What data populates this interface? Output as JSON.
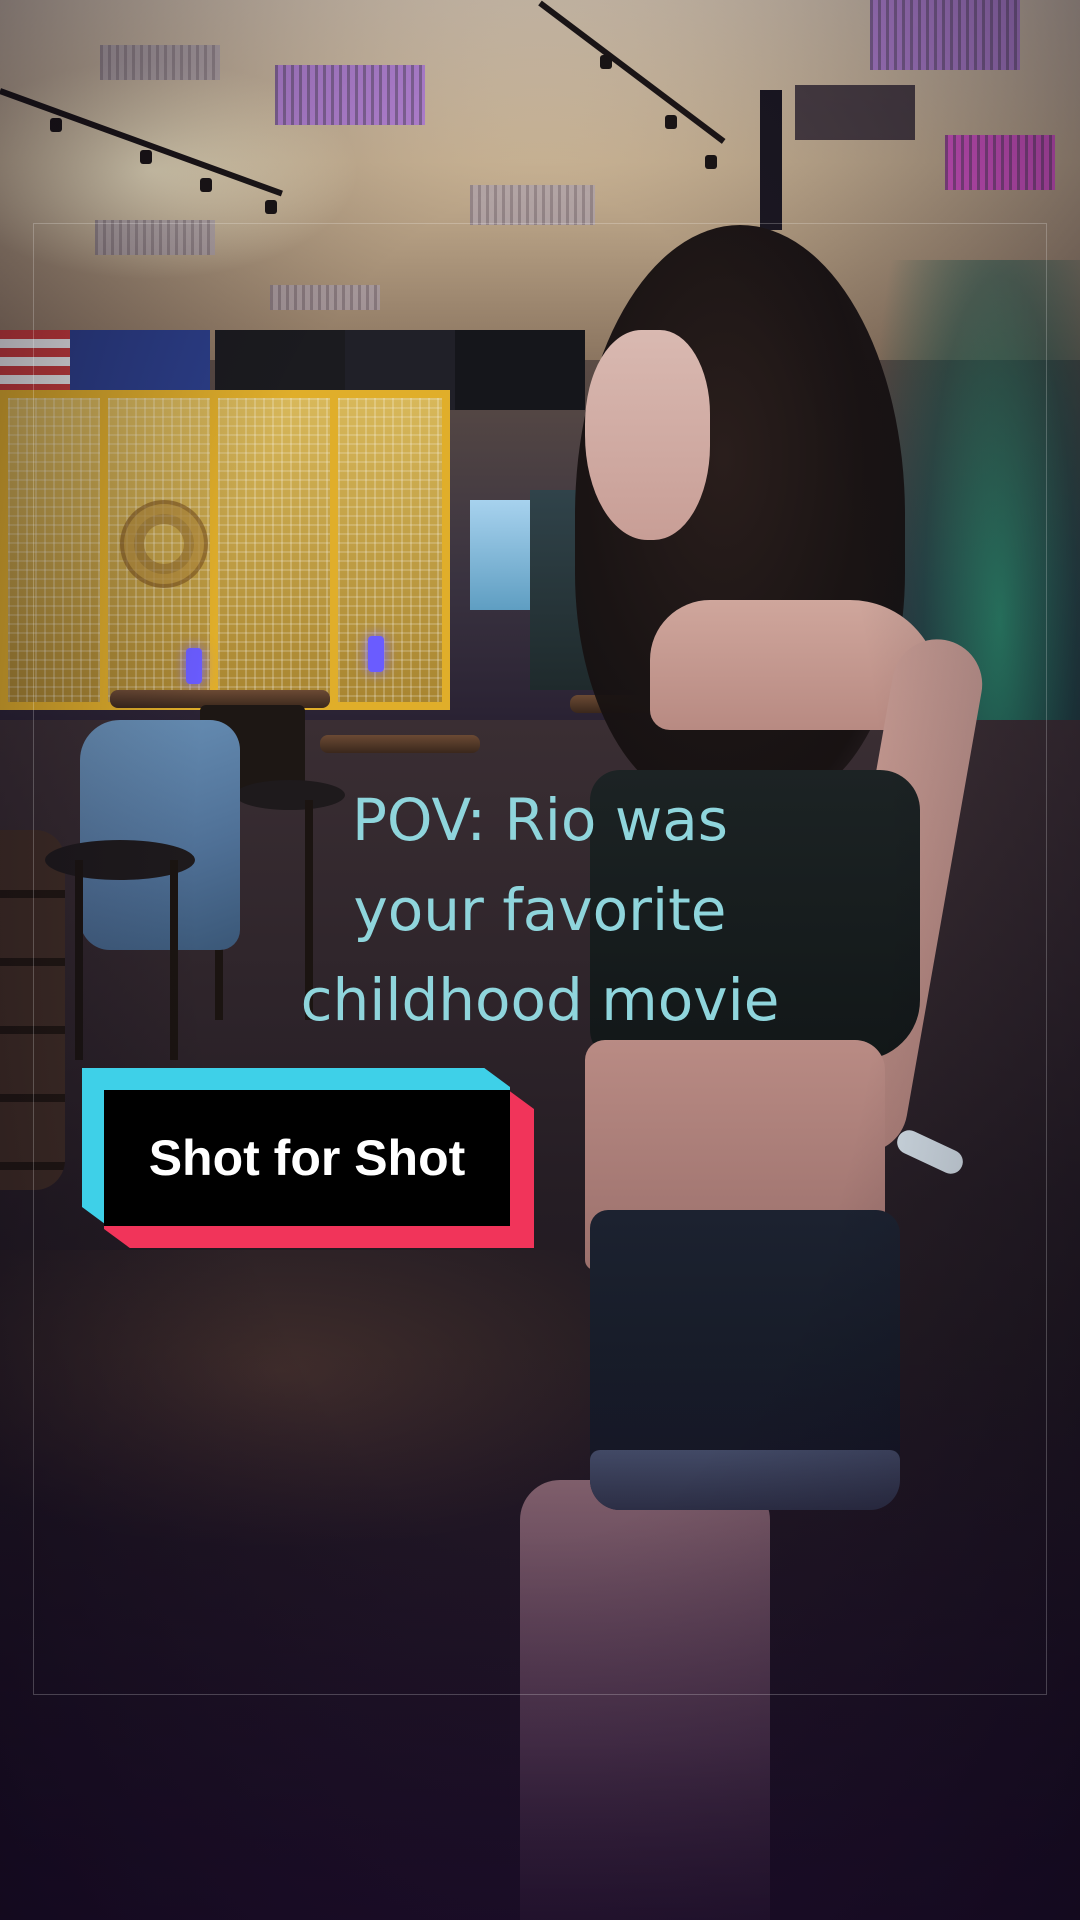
{
  "caption": {
    "line1": "POV: Rio was",
    "line2": "your favorite",
    "line3": "childhood movie"
  },
  "badge": {
    "label": "Shot for Shot"
  },
  "colors": {
    "caption_text": "#8fd5dc",
    "badge_cyan": "#3ed0e8",
    "badge_red": "#f1345a",
    "badge_fill": "#000000",
    "badge_text": "#ffffff"
  }
}
